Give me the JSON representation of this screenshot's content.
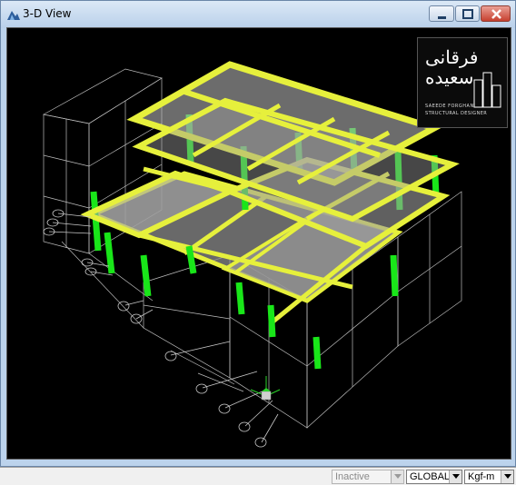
{
  "window": {
    "title": "3-D View",
    "icon": "etabs-3d-view-icon",
    "controls": [
      "minimize",
      "maximize",
      "close"
    ]
  },
  "logo": {
    "script": "فرقانی سعیده",
    "line1": "SAEEDE FORGHANI",
    "line2": "STRUCTURAL DESIGNER"
  },
  "grid_labels": [
    "A",
    "B",
    "C",
    "D",
    "E",
    "F",
    "G",
    "H",
    "I",
    "J",
    "K",
    "L"
  ],
  "statusbar": {
    "inactive": "Inactive",
    "coord_system": "GLOBAL",
    "units": "Kgf-m"
  },
  "colors": {
    "viewport_bg": "#000000",
    "beams": "#e6f03c",
    "columns": "#19e619",
    "slab": "#9a9a9a",
    "wireframe": "#c8c8c8"
  }
}
